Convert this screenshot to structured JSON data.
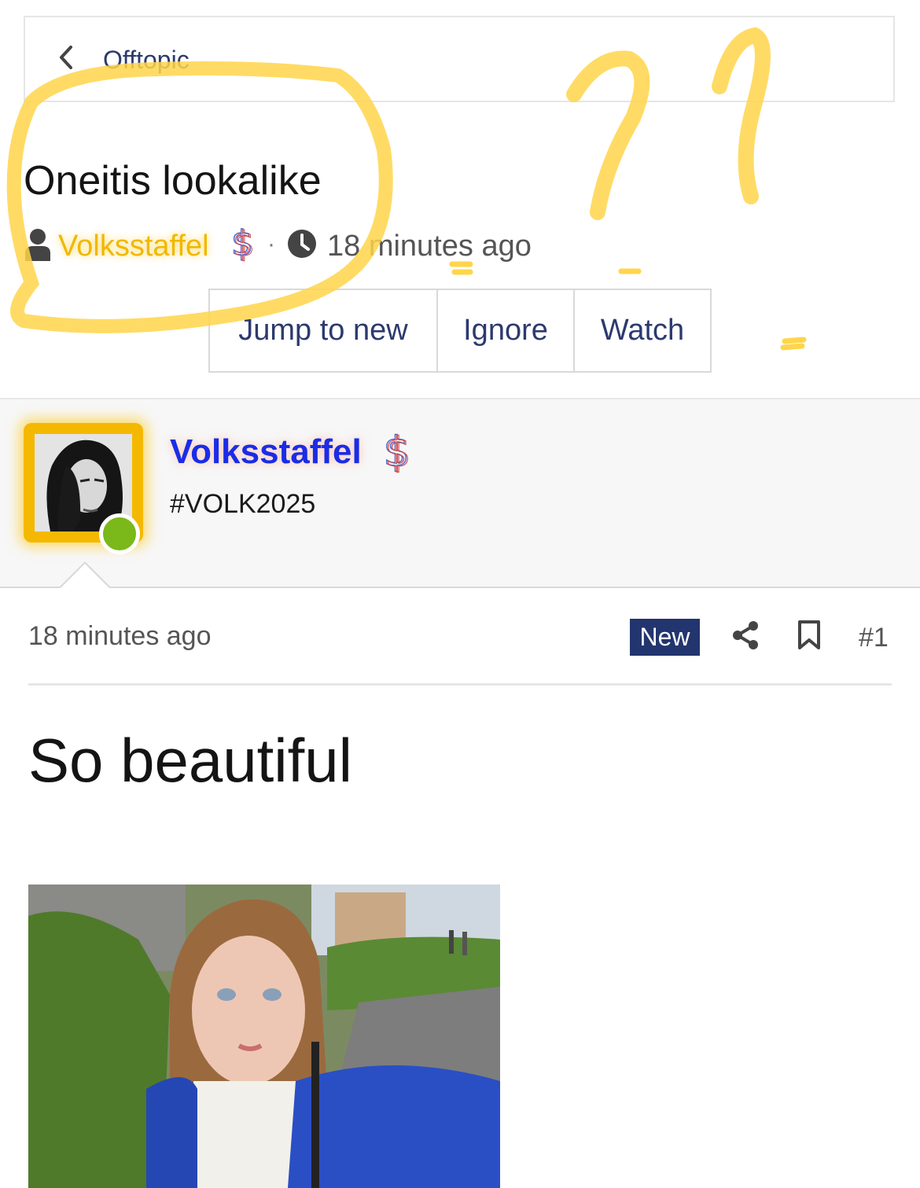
{
  "breadcrumb": {
    "label": "Offtopic"
  },
  "thread": {
    "title": "Oneitis lookalike",
    "author": "Volksstaffel",
    "time": "18 minutes ago",
    "separator": "·"
  },
  "actions": {
    "jump_label": "Jump to new",
    "ignore_label": "Ignore",
    "watch_label": "Watch"
  },
  "post": {
    "author": "Volksstaffel",
    "user_title": "#VOLK2025",
    "time": "18 minutes ago",
    "badge": "New",
    "number": "#1",
    "body": "So beautiful"
  },
  "icons": {
    "back": "chevron-left-icon",
    "user": "user-icon",
    "clock": "clock-icon",
    "donor": "dollar-icon",
    "share": "share-icon",
    "bookmark": "bookmark-icon"
  },
  "colors": {
    "link": "#2d3a6e",
    "author_highlight": "#f0b800",
    "username": "#1a2ce6",
    "badge_bg": "#22356e",
    "online": "#7bb81a",
    "annotation": "#ffd54a"
  }
}
